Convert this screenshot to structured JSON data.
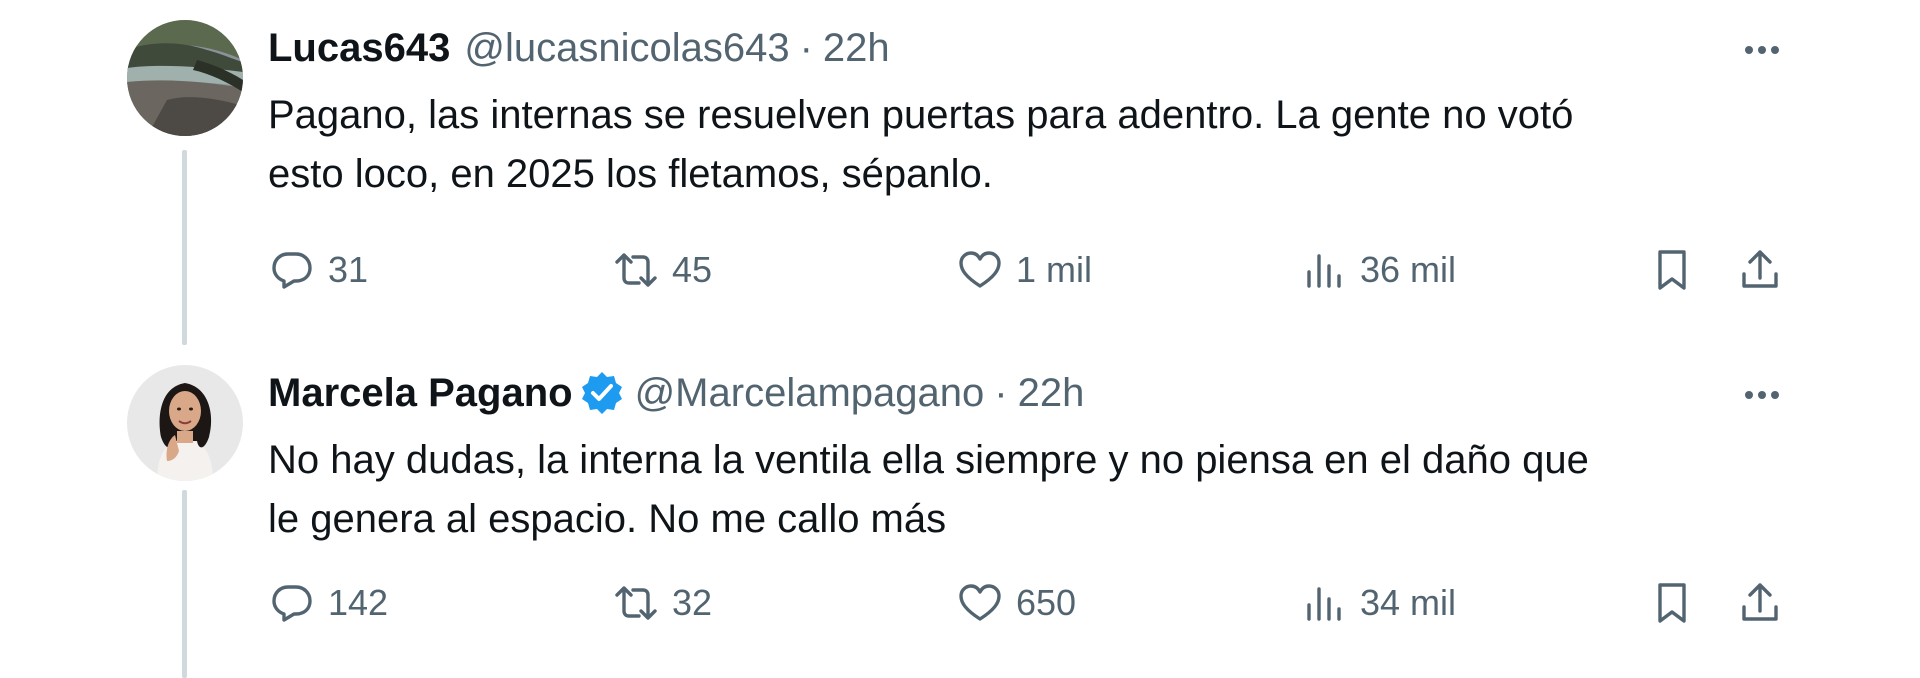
{
  "tweets": [
    {
      "name": "Lucas643",
      "verified": false,
      "handle": "@lucasnicolas643",
      "separator": "·",
      "time": "22h",
      "text_lines": [
        "Pagano, las internas se resuelven puertas para adentro. La gente no votó",
        "esto loco, en 2025 los fletamos, sépanlo."
      ],
      "stats": {
        "replies": "31",
        "retweets": "45",
        "likes": "1 mil",
        "views": "36 mil"
      },
      "avatar_icon": "landscape-avatar"
    },
    {
      "name": "Marcela Pagano",
      "verified": true,
      "handle": "@Marcelampagano",
      "separator": "·",
      "time": "22h",
      "text_lines": [
        "No hay dudas, la interna la ventila ella siempre y no piensa en el daño que",
        "le genera al espacio. No me callo más"
      ],
      "stats": {
        "replies": "142",
        "retweets": "32",
        "likes": "650",
        "views": "34 mil"
      },
      "avatar_icon": "person-avatar"
    }
  ],
  "colors": {
    "primary_text": "#0f1419",
    "secondary_text": "#536471",
    "verified_blue": "#1d9bf0",
    "thread_line": "#cfd9de",
    "background": "#ffffff"
  },
  "icons": [
    "reply-icon",
    "retweet-icon",
    "like-icon",
    "views-icon",
    "bookmark-icon",
    "share-icon",
    "more-icon",
    "verified-badge-icon"
  ]
}
